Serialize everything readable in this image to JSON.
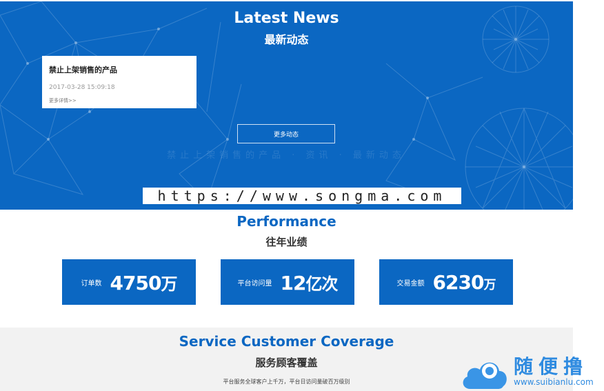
{
  "news": {
    "title": "Latest News",
    "subtitle": "最新动态",
    "card": {
      "title": "禁止上架销售的产品",
      "date": "2017-03-28 15:09:18",
      "more_link": "更多详情>>"
    },
    "more_button": "更多动态",
    "faint_text": "禁止上架销售的产品 · 资讯 · 最新动态"
  },
  "watermark_url": "https://www.songma.com",
  "performance": {
    "title": "Performance",
    "subtitle": "往年业绩",
    "stats": [
      {
        "label": "订单数",
        "number": "4750",
        "unit": "万"
      },
      {
        "label": "平台访问量",
        "number": "12",
        "unit": "亿次"
      },
      {
        "label": "交易金额",
        "number": "6230",
        "unit": "万"
      }
    ]
  },
  "coverage": {
    "title": "Service Customer Coverage",
    "subtitle": "服务顾客覆盖",
    "description": "平台服务全球客户上千万，平台日访问量破百万级别"
  },
  "watermark_logo": {
    "brand": "随便撸",
    "url": "www.suibianlu.com"
  },
  "colors": {
    "primary_blue": "#0b67c2",
    "coverage_bg": "#f2f2f2",
    "watermark_blue": "#2f8be0"
  }
}
